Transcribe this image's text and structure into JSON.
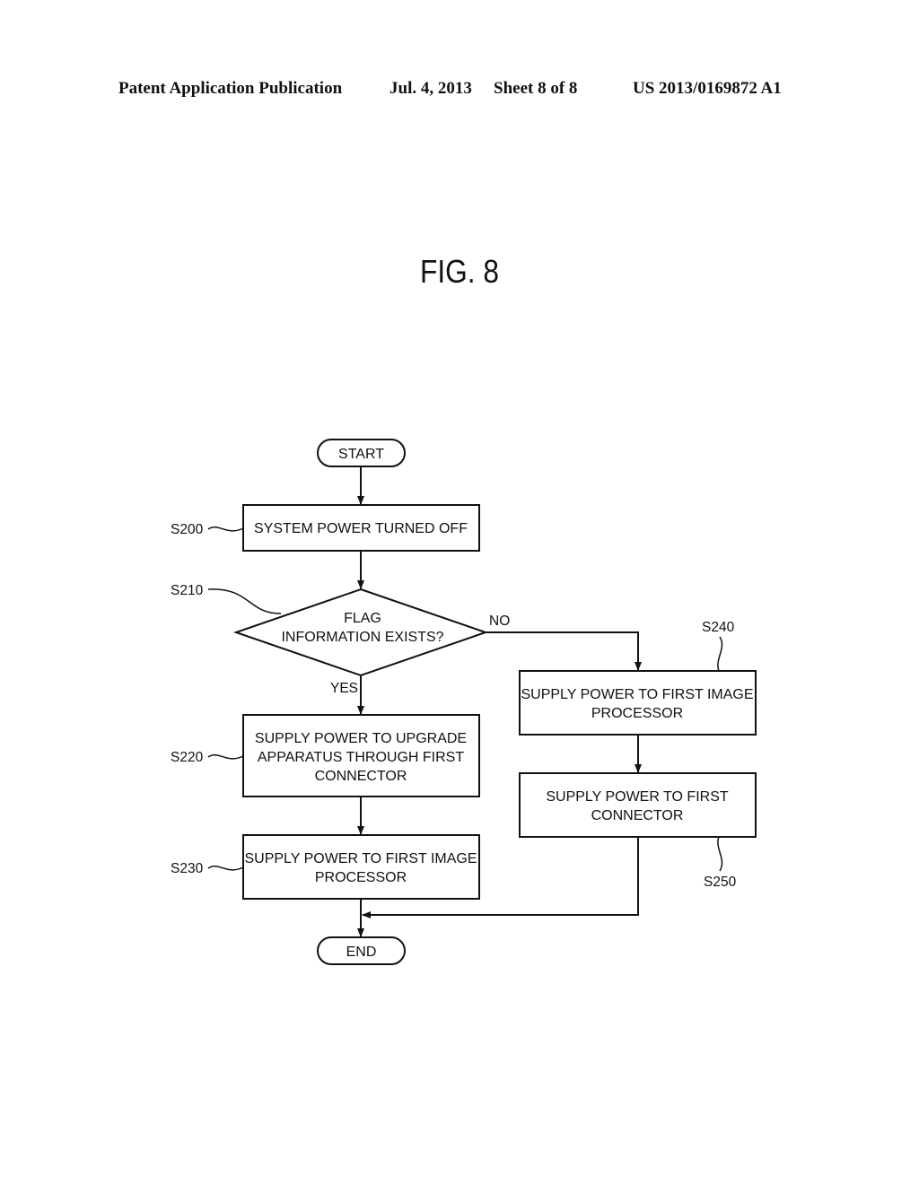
{
  "header": {
    "publication": "Patent Application Publication",
    "date": "Jul. 4, 2013",
    "sheet": "Sheet 8 of 8",
    "number": "US 2013/0169872 A1"
  },
  "figure": {
    "title": "FIG. 8"
  },
  "flowchart": {
    "start": "START",
    "end": "END",
    "steps": {
      "s200": {
        "id": "S200",
        "lines": [
          "SYSTEM POWER TURNED OFF"
        ]
      },
      "s210": {
        "id": "S210",
        "lines": [
          "FLAG",
          "INFORMATION EXISTS?"
        ]
      },
      "s220": {
        "id": "S220",
        "lines": [
          "SUPPLY POWER TO UPGRADE",
          "APPARATUS THROUGH FIRST",
          "CONNECTOR"
        ]
      },
      "s230": {
        "id": "S230",
        "lines": [
          "SUPPLY POWER TO FIRST IMAGE",
          "PROCESSOR"
        ]
      },
      "s240": {
        "id": "S240",
        "lines": [
          "SUPPLY POWER TO FIRST IMAGE",
          "PROCESSOR"
        ]
      },
      "s250": {
        "id": "S250",
        "lines": [
          "SUPPLY POWER TO FIRST",
          "CONNECTOR"
        ]
      }
    },
    "branches": {
      "yes": "YES",
      "no": "NO"
    }
  }
}
